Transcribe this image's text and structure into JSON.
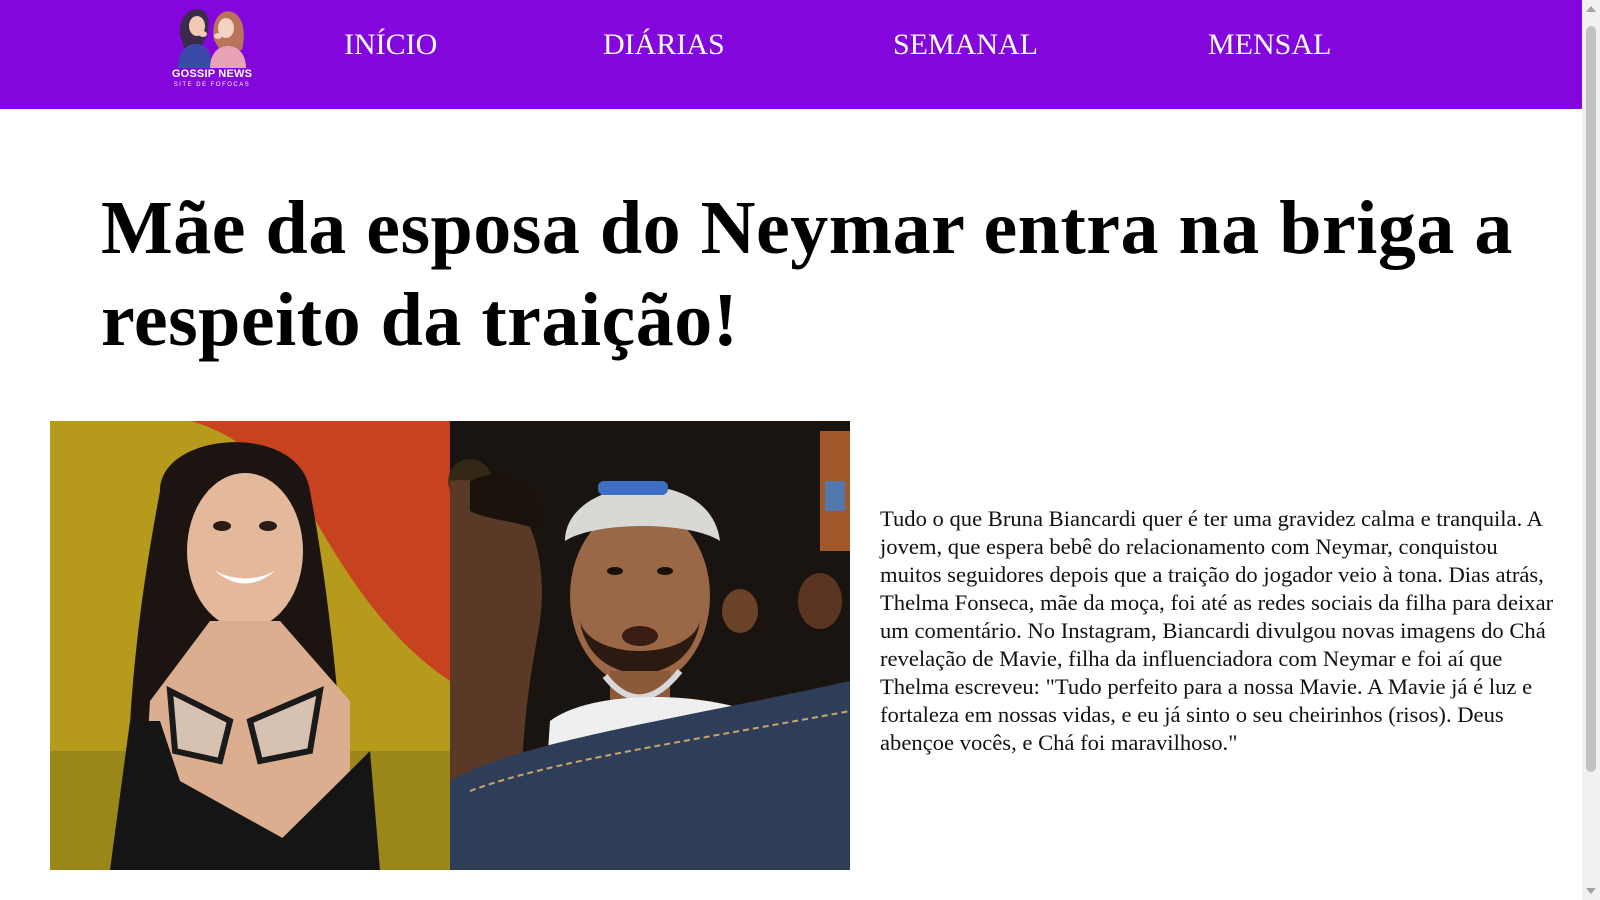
{
  "header": {
    "logo": {
      "title": "GOSSIP NEWS",
      "subtitle": "SITE DE FOFOCAS",
      "icon": "two-women-whispering-icon"
    },
    "nav": [
      {
        "label": "INÍCIO"
      },
      {
        "label": "DIÁRIAS"
      },
      {
        "label": "SEMANAL"
      },
      {
        "label": "MENSAL"
      }
    ],
    "background_color": "#8306dc"
  },
  "article": {
    "headline": "Mãe da esposa do Neymar entra na briga a respeito da traição!",
    "body": "Tudo o que Bruna Biancardi quer é ter uma gravidez calma e tranquila. A jovem, que espera bebê do relacionamento com Neymar, conquistou muitos seguidores depois que a traição do jogador veio à tona. Dias atrás, Thelma Fonseca, mãe da moça, foi até as redes sociais da filha para deixar um comentário. No Instagram, Biancardi divulgou novas imagens do Chá revelação de Mavie, filha da influenciadora com Neymar e foi aí que Thelma escreveu: \"Tudo perfeito para a nossa Mavie. A Mavie já é luz e fortaleza em nossas vidas, e eu já sinto o seu cheirinhos (risos). Deus abençoe vocês, e Chá foi maravilhoso.\""
  }
}
